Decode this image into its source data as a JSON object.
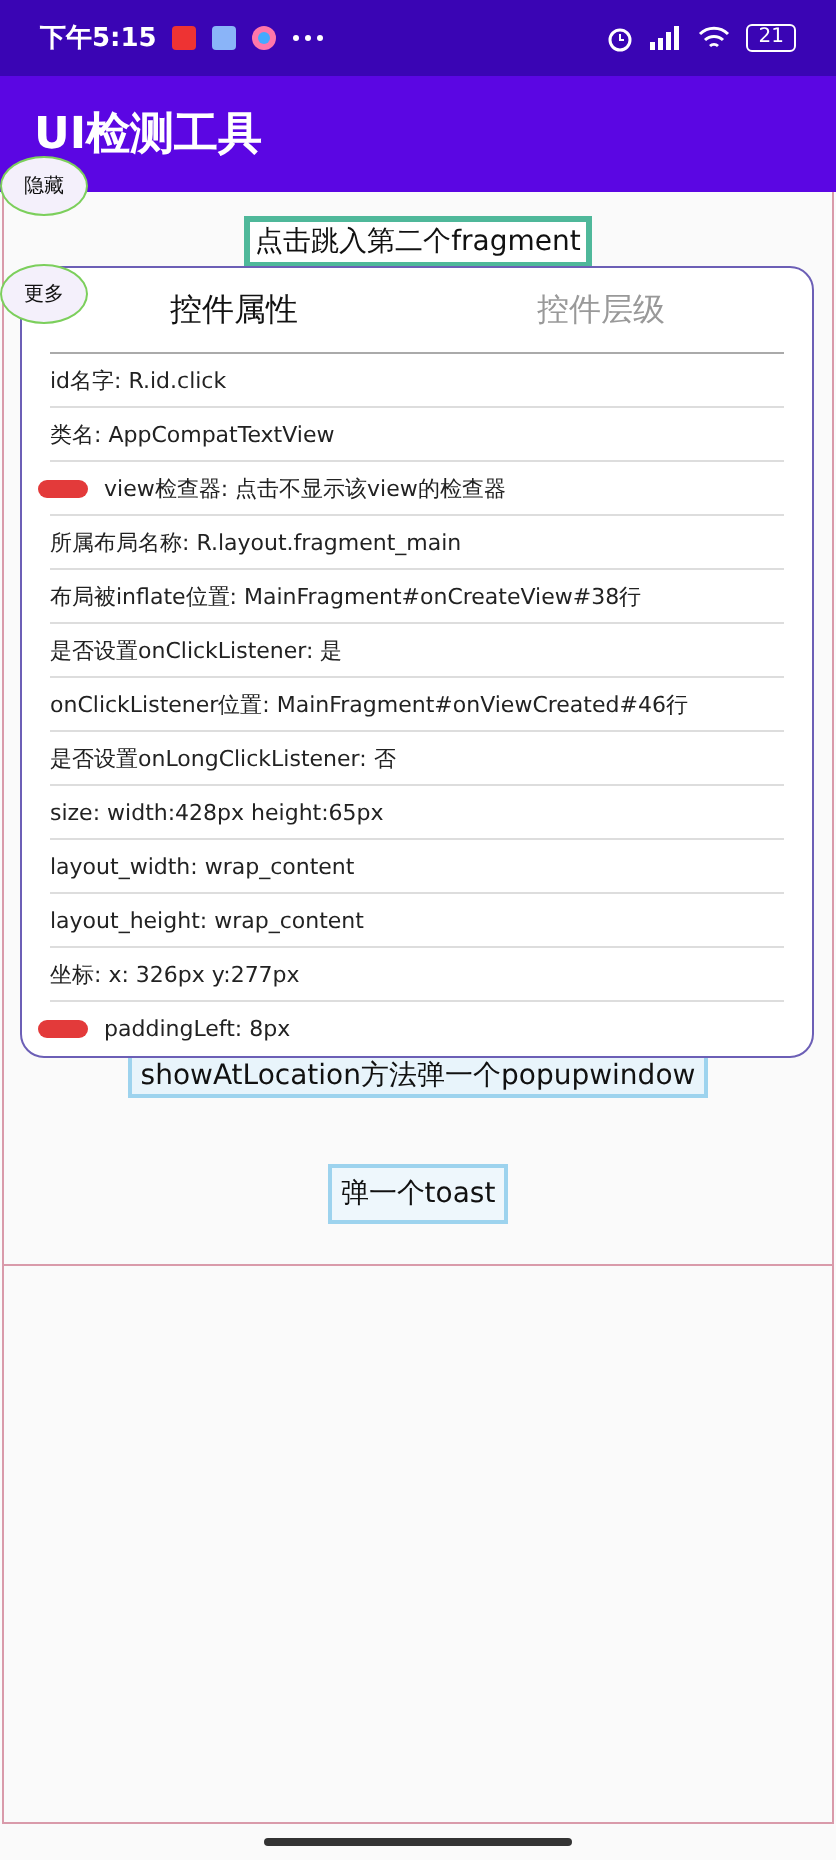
{
  "status_bar": {
    "time": "下午5:15",
    "battery": "21"
  },
  "app_bar": {
    "title": "UI检测工具"
  },
  "floating_buttons": [
    {
      "label": "隐藏"
    },
    {
      "label": "更多"
    }
  ],
  "content": {
    "buttons": [
      "点击跳入第二个fragment",
      "showAtLocation方法弹一个popupwindow",
      "弹一个toast"
    ]
  },
  "dialog": {
    "tabs": [
      {
        "label": "控件属性",
        "selected": true
      },
      {
        "label": "控件层级",
        "selected": false
      }
    ],
    "rows": [
      {
        "kind": "plain",
        "text": "id名字: R.id.click"
      },
      {
        "kind": "plain",
        "text": "类名: AppCompatTextView"
      },
      {
        "kind": "badge",
        "text": "view检查器: 点击不显示该view的检查器"
      },
      {
        "kind": "plain",
        "text": "所属布局名称: R.layout.fragment_main"
      },
      {
        "kind": "plain",
        "text": "布局被inflate位置: MainFragment#onCreateView#38行"
      },
      {
        "kind": "plain",
        "text": "是否设置onClickListener: 是"
      },
      {
        "kind": "plain",
        "text": "onClickListener位置: MainFragment#onViewCreated#46行"
      },
      {
        "kind": "plain",
        "text": "是否设置onLongClickListener: 否"
      },
      {
        "kind": "plain",
        "text": "size: width:428px  height:65px"
      },
      {
        "kind": "plain",
        "text": "layout_width: wrap_content"
      },
      {
        "kind": "plain",
        "text": "layout_height: wrap_content"
      },
      {
        "kind": "plain",
        "text": "坐标: x: 326px y:277px"
      },
      {
        "kind": "badge",
        "text": "paddingLeft: 8px"
      }
    ]
  }
}
